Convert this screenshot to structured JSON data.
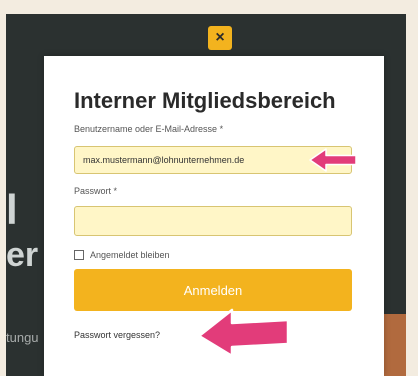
{
  "modal": {
    "close_symbol": "×",
    "title": "Interner Mitgliedsbereich",
    "username_label": "Benutzername oder E-Mail-Adresse *",
    "username_value": "max.mustermann@lohnunternehmen.de",
    "password_label": "Passwort *",
    "password_value": "",
    "remember_label": "Angemeldet bleiben",
    "submit_label": "Anmelden",
    "forgot_link": "Passwort vergessen?"
  },
  "background": {
    "fragment_1": "l",
    "fragment_2": "er",
    "fragment_3": "tungu"
  },
  "colors": {
    "accent": "#f3b31e",
    "input_bg": "#fff6c7",
    "arrow": "#e23c7a",
    "overlay": "#2b3130"
  },
  "icons": {
    "close": "close-icon",
    "annotation": "arrow-left-icon"
  }
}
